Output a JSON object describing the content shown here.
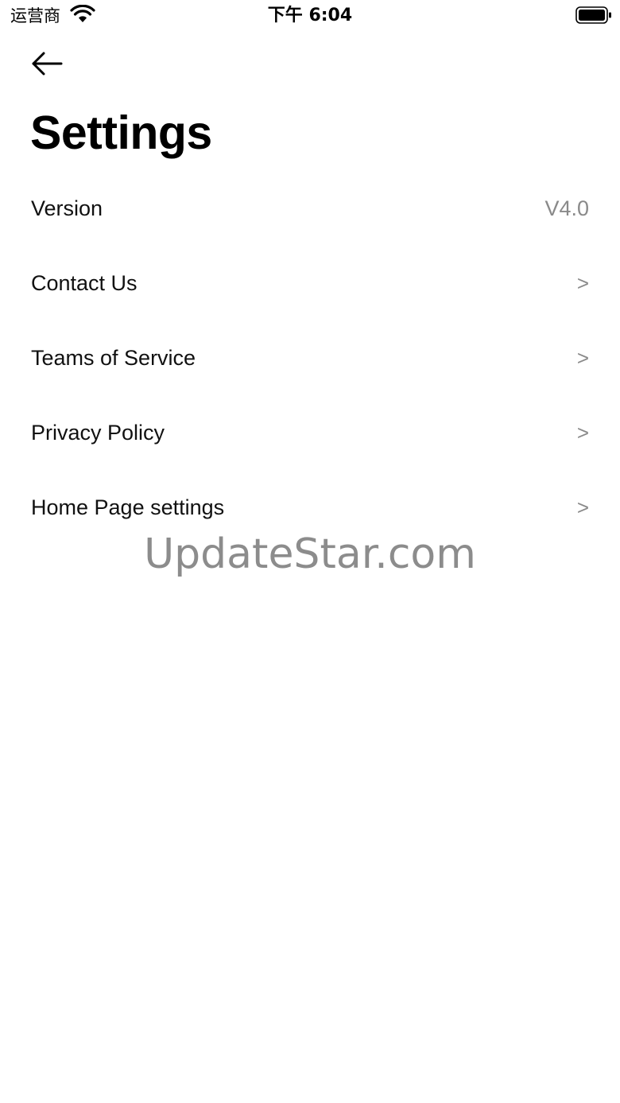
{
  "status_bar": {
    "carrier": "运营商",
    "time": "下午 6:04",
    "wifi_icon": "wifi-icon",
    "battery_icon": "battery-icon"
  },
  "nav": {
    "back_icon": "arrow-left-icon"
  },
  "page": {
    "title": "Settings"
  },
  "settings": {
    "items": [
      {
        "label": "Version",
        "value": "V4.0"
      },
      {
        "label": "Contact Us",
        "chevron": ">"
      },
      {
        "label": "Teams of Service",
        "chevron": ">"
      },
      {
        "label": "Privacy Policy",
        "chevron": ">"
      },
      {
        "label": "Home Page settings",
        "chevron": ">"
      }
    ]
  },
  "watermark": {
    "text": "UpdateStar.com"
  },
  "colors": {
    "background": "#ffffff",
    "text_primary": "#111111",
    "text_secondary": "#8a8a8a",
    "watermark": "#8c8c8c"
  }
}
